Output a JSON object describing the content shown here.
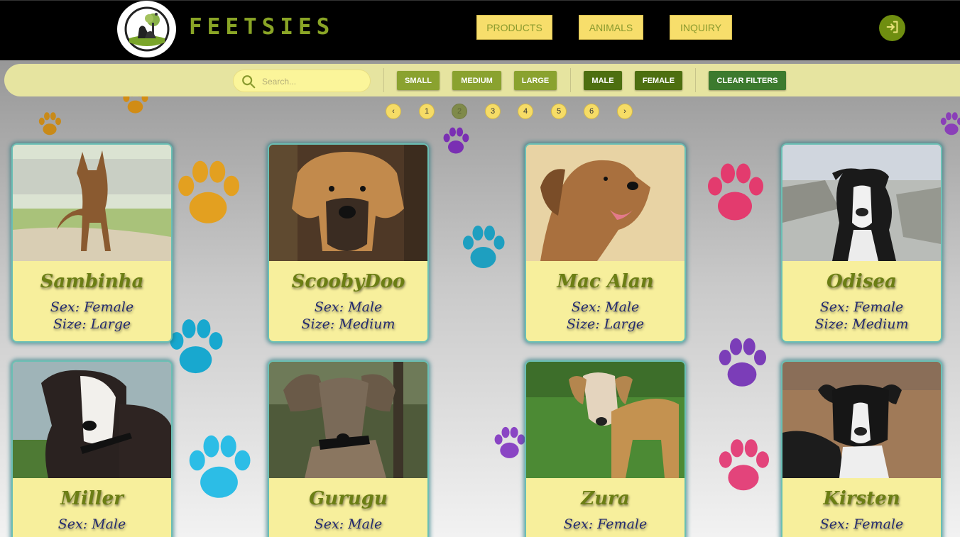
{
  "brand": {
    "name": "FEETSIES",
    "logo_icon": "pets-logo-icon"
  },
  "nav": {
    "products": "PRODUCTS",
    "animals": "ANIMALS",
    "inquiry": "INQUIRY",
    "login_icon": "login-icon"
  },
  "filters": {
    "search_placeholder": "Search...",
    "small": "SMALL",
    "medium": "MEDIUM",
    "large": "LARGE",
    "male": "MALE",
    "female": "FEMALE",
    "clear": "CLEAR FILTERS"
  },
  "pagination": {
    "prev": "‹",
    "next": "›",
    "pages": [
      "1",
      "2",
      "3",
      "4",
      "5",
      "6"
    ],
    "current": "2"
  },
  "animals": [
    {
      "name": "Sambinha",
      "sex": "Sex: Female",
      "size": "Size: Large"
    },
    {
      "name": "ScoobyDoo",
      "sex": "Sex: Male",
      "size": "Size: Medium"
    },
    {
      "name": "Mac Alan",
      "sex": "Sex: Male",
      "size": "Size: Large"
    },
    {
      "name": "Odisea",
      "sex": "Sex: Female",
      "size": "Size: Medium"
    },
    {
      "name": "Miller",
      "sex": "Sex: Male",
      "size": ""
    },
    {
      "name": "Gurugu",
      "sex": "Sex: Male",
      "size": ""
    },
    {
      "name": "Zura",
      "sex": "Sex: Female",
      "size": ""
    },
    {
      "name": "Kirsten",
      "sex": "Sex: Female",
      "size": ""
    }
  ],
  "colors": {
    "header_bg": "#000000",
    "brand_green": "#8aa526",
    "nav_button": "#f7de6b",
    "filter_bar": "#e6e4a0",
    "card_bg": "#f7ef9c",
    "card_name": "#6b7e14",
    "card_text": "#232a6e"
  }
}
